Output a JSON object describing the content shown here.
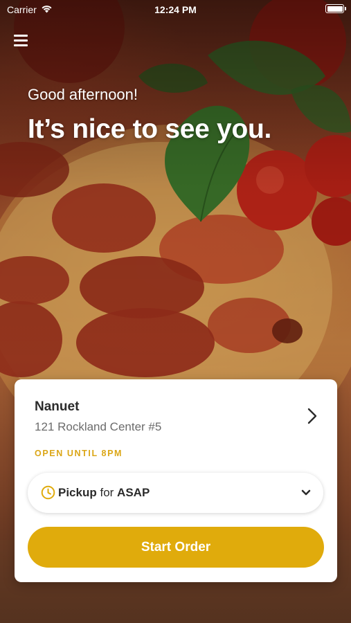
{
  "status_bar": {
    "carrier": "Carrier",
    "time": "12:24 PM",
    "wifi_icon": "wifi-icon",
    "battery_icon": "battery-icon"
  },
  "header": {
    "menu_icon": "hamburger-menu-icon"
  },
  "greeting": {
    "subtitle": "Good afternoon!",
    "title": "It’s nice to see you."
  },
  "location": {
    "name": "Nanuet",
    "address": "121 Rockland Center #5",
    "hours": "OPEN UNTIL 8PM",
    "chevron_icon": "chevron-right-icon"
  },
  "order_type": {
    "icon": "clock-icon",
    "mode": "Pickup",
    "connector": " for ",
    "time": "ASAP",
    "dropdown_icon": "chevron-down-icon"
  },
  "actions": {
    "start_order_label": "Start Order"
  },
  "colors": {
    "accent": "#e0ab0c",
    "hours_text": "#dba616",
    "card_background": "#ffffff"
  },
  "background_image": {
    "subject": "pepperoni-pizza-with-tomatoes-and-basil"
  }
}
